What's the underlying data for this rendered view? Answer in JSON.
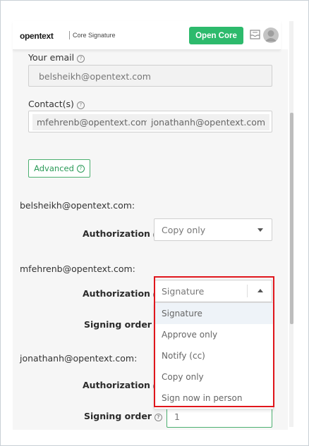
{
  "header": {
    "logo_text": "opentext",
    "product_name": "Core Signature",
    "open_core_label": "Open Core"
  },
  "form": {
    "your_email_label": "Your email",
    "your_email_value": "belsheikh@opentext.com",
    "contacts_label": "Contact(s)",
    "contacts": [
      "mfehrenb@opentext.com",
      "jonathanh@opentext.com"
    ],
    "advanced_label": "Advanced"
  },
  "recipients": [
    {
      "email_heading": "belsheikh@opentext.com:",
      "authorization_label": "Authorization",
      "authorization_value": "Copy only"
    },
    {
      "email_heading": "mfehrenb@opentext.com:",
      "authorization_label": "Authorization",
      "authorization_value": "Signature",
      "signing_order_label": "Signing order"
    },
    {
      "email_heading": "jonathanh@opentext.com:",
      "authorization_label": "Authorization",
      "signing_order_label": "Signing order",
      "signing_order_value": "1"
    }
  ],
  "dropdown": {
    "options": [
      "Signature",
      "Approve only",
      "Notify (cc)",
      "Copy only",
      "Sign now in person"
    ],
    "highlighted": "Signature"
  },
  "colors": {
    "brand_green": "#2dba6c",
    "highlight_red": "#e0161c"
  },
  "icons": {
    "help": "question-circle-icon",
    "inbox": "inbox-icon",
    "avatar": "user-avatar-icon"
  }
}
